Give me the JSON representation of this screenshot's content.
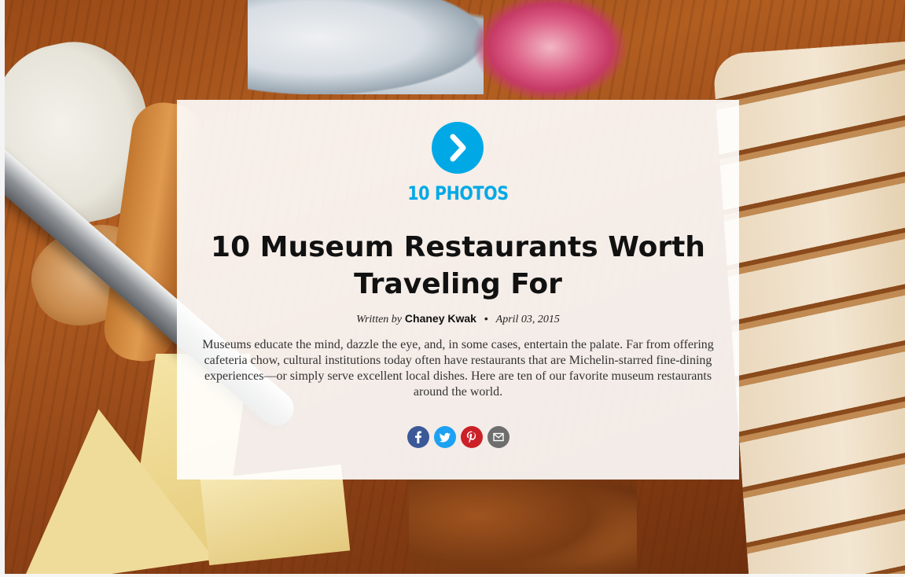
{
  "gallery": {
    "photo_count_label": "10 PHOTOS",
    "title": "10 Museum Restaurants Worth Traveling For",
    "byline_prefix": "Written by",
    "author": "Chaney Kwak",
    "separator": "•",
    "date": "April 03, 2015",
    "description": "Museums educate the mind, dazzle the eye, and, in some cases, entertain the palate. Far from offering cafeteria chow, cultural institutions today often have restaurants that are Michelin-starred fine-dining experiences—or simply serve excellent local dishes. Here are ten of our favorite museum restaurants around the world."
  },
  "share_buttons": [
    {
      "icon": "facebook-icon",
      "color": "#3b5998"
    },
    {
      "icon": "twitter-icon",
      "color": "#1da1f2"
    },
    {
      "icon": "pinterest-icon",
      "color": "#cb2027"
    },
    {
      "icon": "email-icon",
      "color": "#6e6e6e"
    }
  ],
  "colors": {
    "accent": "#00a9e6",
    "card_background": "#ffffff",
    "title_text": "#111111"
  }
}
